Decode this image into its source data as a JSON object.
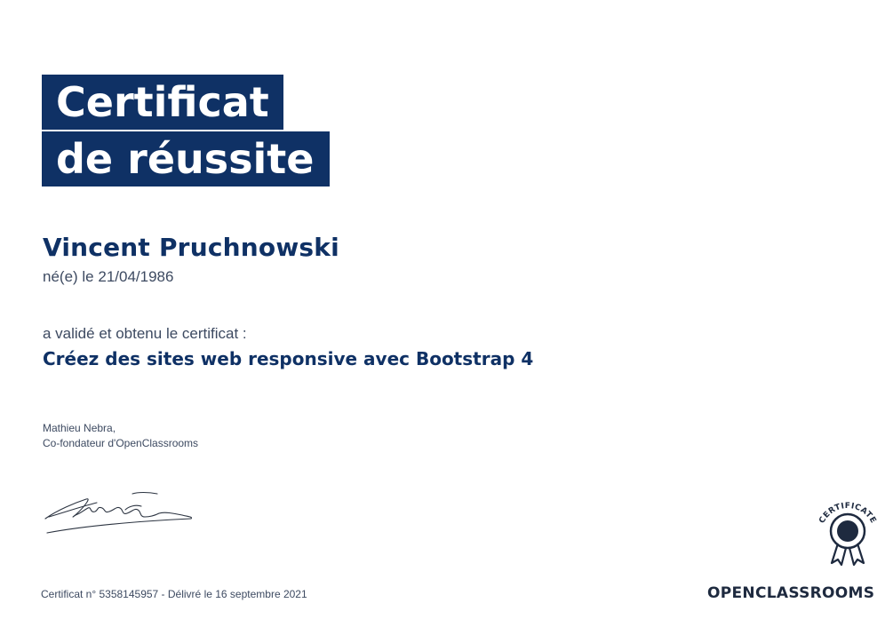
{
  "certificate": {
    "title_line1": "Certificat",
    "title_line2": "de réussite",
    "recipient_name": "Vincent Pruchnowski",
    "birth_line": "né(e) le 21/04/1986",
    "validated_line": "a validé et obtenu le certificat :",
    "course_title": "Créez des sites web responsive avec Bootstrap 4",
    "signer_name": "Mathieu Nebra,",
    "signer_role": "Co-fondateur d'OpenClassrooms",
    "footer": "Certificat n° 5358145957 - Délivré le 16 septembre 2021"
  },
  "badge": {
    "label": "CERTIFICATE",
    "icon": "award-ribbon-icon"
  },
  "logo": {
    "text": "OPENCLASSROOMS"
  },
  "colors": {
    "primary": "#0f3165",
    "text": "#3d4a61",
    "badge": "#1e2a3f"
  }
}
